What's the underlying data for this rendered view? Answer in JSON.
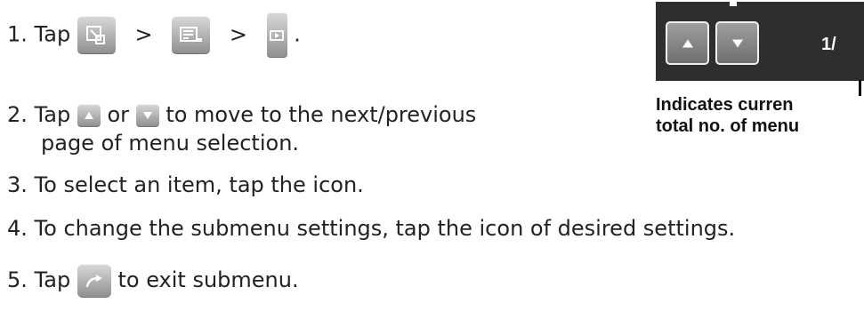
{
  "steps": [
    {
      "number": "1.",
      "text_before": "Tap",
      "separator_1": ">",
      "separator_2": ">",
      "text_after": "."
    },
    {
      "number": "2.",
      "text_before": "Tap",
      "text_middle": "or",
      "text_after": "to move to the next/previous",
      "text_line2": "page of menu selection."
    },
    {
      "number": "3.",
      "text": "To select an item, tap the icon."
    },
    {
      "number": "4.",
      "text": "To change the submenu settings, tap the icon of desired settings."
    },
    {
      "number": "5.",
      "text_before": "Tap",
      "text_after": "to exit submenu."
    }
  ],
  "panel": {
    "page_indicator": "1/",
    "callout_line1": "Indicates curren",
    "callout_line2": "total no. of menu"
  },
  "icons": [
    "mode-select-icon",
    "menu-list-icon",
    "playback-icon",
    "page-up-icon",
    "page-down-icon",
    "exit-submenu-icon"
  ],
  "colors": {
    "text": "#222222",
    "button_light": "#d9d9d9",
    "button_dark": "#8e8e8e",
    "panel": "#2e2e2e"
  }
}
